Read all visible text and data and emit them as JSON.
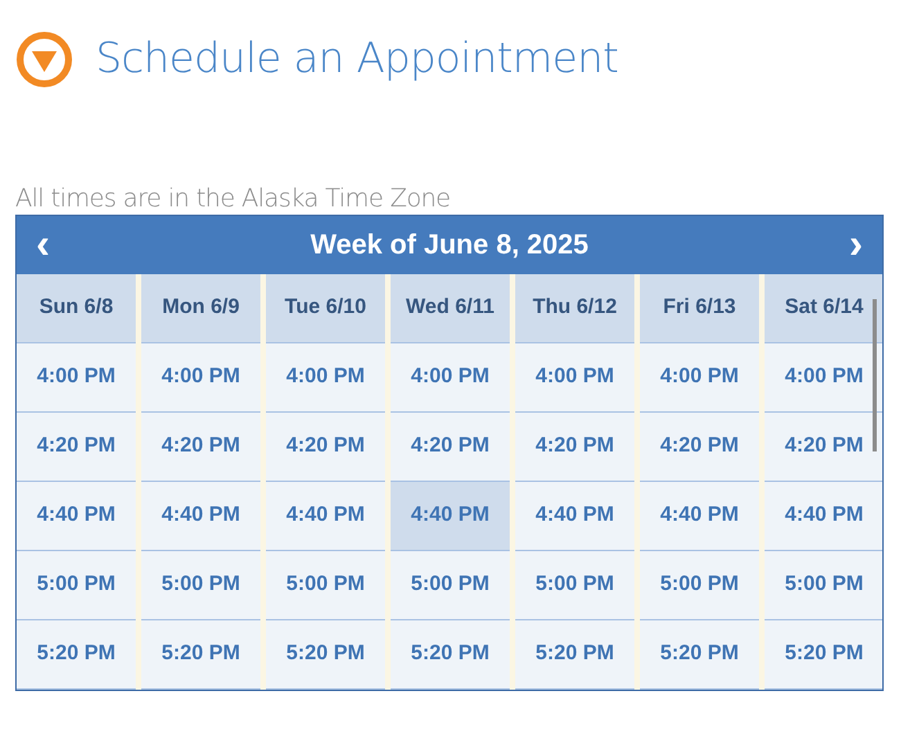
{
  "title": "Schedule an Appointment",
  "timezone_note": "All times are in the Alaska Time Zone",
  "calendar": {
    "prev": "‹",
    "heading": "Week of June 8, 2025",
    "next": "›",
    "days": [
      {
        "label": "Sun 6/8",
        "slots": [
          {
            "time": "4:00 PM",
            "selected": false
          },
          {
            "time": "4:20 PM",
            "selected": false
          },
          {
            "time": "4:40 PM",
            "selected": false
          },
          {
            "time": "5:00 PM",
            "selected": false
          },
          {
            "time": "5:20 PM",
            "selected": false
          }
        ]
      },
      {
        "label": "Mon 6/9",
        "slots": [
          {
            "time": "4:00 PM",
            "selected": false
          },
          {
            "time": "4:20 PM",
            "selected": false
          },
          {
            "time": "4:40 PM",
            "selected": false
          },
          {
            "time": "5:00 PM",
            "selected": false
          },
          {
            "time": "5:20 PM",
            "selected": false
          }
        ]
      },
      {
        "label": "Tue 6/10",
        "slots": [
          {
            "time": "4:00 PM",
            "selected": false
          },
          {
            "time": "4:20 PM",
            "selected": false
          },
          {
            "time": "4:40 PM",
            "selected": false
          },
          {
            "time": "5:00 PM",
            "selected": false
          },
          {
            "time": "5:20 PM",
            "selected": false
          }
        ]
      },
      {
        "label": "Wed 6/11",
        "slots": [
          {
            "time": "4:00 PM",
            "selected": false
          },
          {
            "time": "4:20 PM",
            "selected": false
          },
          {
            "time": "4:40 PM",
            "selected": true
          },
          {
            "time": "5:00 PM",
            "selected": false
          },
          {
            "time": "5:20 PM",
            "selected": false
          }
        ]
      },
      {
        "label": "Thu 6/12",
        "slots": [
          {
            "time": "4:00 PM",
            "selected": false
          },
          {
            "time": "4:20 PM",
            "selected": false
          },
          {
            "time": "4:40 PM",
            "selected": false
          },
          {
            "time": "5:00 PM",
            "selected": false
          },
          {
            "time": "5:20 PM",
            "selected": false
          }
        ]
      },
      {
        "label": "Fri 6/13",
        "slots": [
          {
            "time": "4:00 PM",
            "selected": false
          },
          {
            "time": "4:20 PM",
            "selected": false
          },
          {
            "time": "4:40 PM",
            "selected": false
          },
          {
            "time": "5:00 PM",
            "selected": false
          },
          {
            "time": "5:20 PM",
            "selected": false
          }
        ]
      },
      {
        "label": "Sat 6/14",
        "slots": [
          {
            "time": "4:00 PM",
            "selected": false
          },
          {
            "time": "4:20 PM",
            "selected": false
          },
          {
            "time": "4:40 PM",
            "selected": false
          },
          {
            "time": "5:00 PM",
            "selected": false
          },
          {
            "time": "5:20 PM",
            "selected": false
          }
        ]
      }
    ]
  }
}
